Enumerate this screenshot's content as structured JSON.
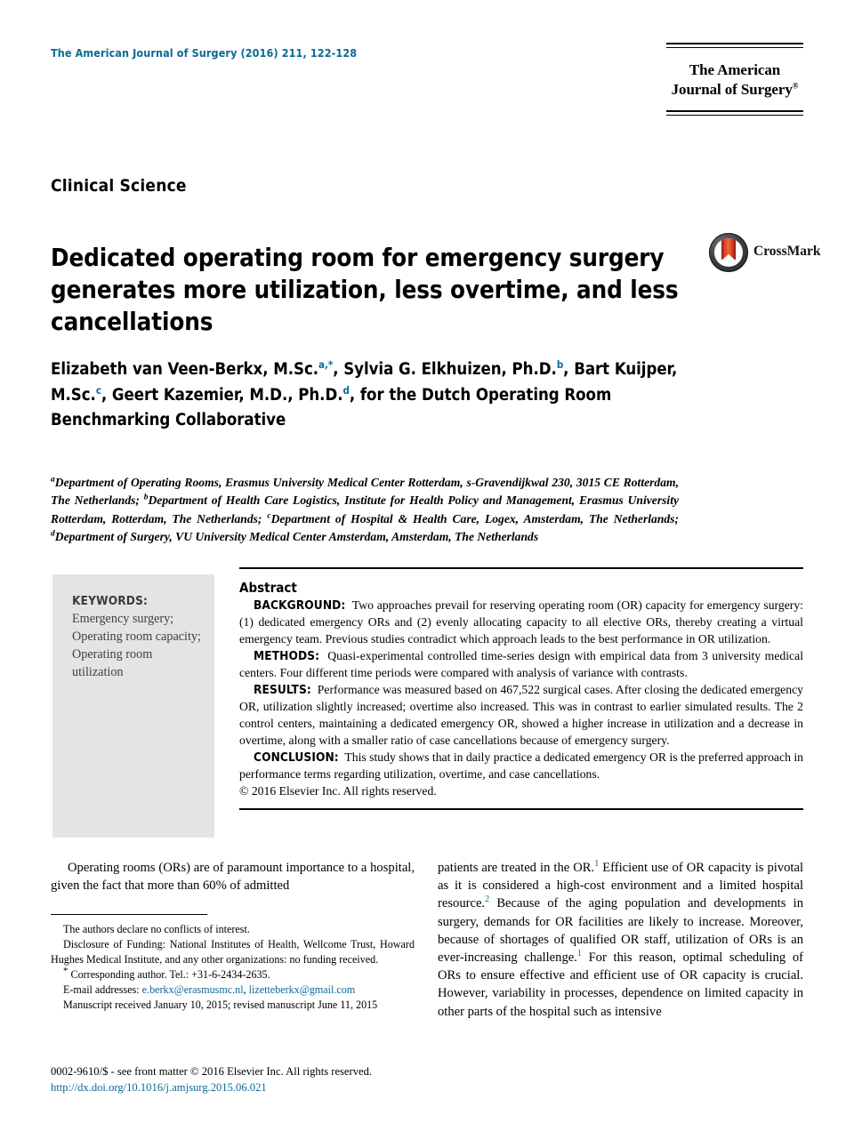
{
  "masthead": {
    "journal_reference": "The American Journal of Surgery (2016) 211, 122-128",
    "logo_line1": "The American",
    "logo_line2": "Journal of Surgery",
    "logo_registered": "®"
  },
  "article": {
    "section_kicker": "Clinical Science",
    "title": "Dedicated operating room for emergency surgery generates more utilization, less overtime, and less cancellations",
    "crossmark_label": "CrossMark"
  },
  "authors": {
    "line1_a": "Elizabeth van Veen-Berkx, M.Sc.",
    "line1_sup1": "a,*",
    "line1_b": ", Sylvia G. Elkhuizen, Ph.D.",
    "line1_sup2": "b",
    "line1_c": ",",
    "line2_a": "Bart Kuijper, M.Sc.",
    "line2_sup1": "c",
    "line2_b": ", Geert Kazemier, M.D., Ph.D.",
    "line2_sup2": "d",
    "line2_c": ", for the Dutch",
    "line3": "Operating Room Benchmarking Collaborative"
  },
  "affiliations": {
    "mark_a": "a",
    "text_a": "Department of Operating Rooms, Erasmus University Medical Center Rotterdam, s-Gravendijkwal 230, 3015 CE Rotterdam, The Netherlands; ",
    "mark_b": "b",
    "text_b": "Department of Health Care Logistics, Institute for Health Policy and Management, Erasmus University Rotterdam, Rotterdam, The Netherlands; ",
    "mark_c": "c",
    "text_c": "Department of Hospital & Health Care, Logex, Amsterdam, The Netherlands; ",
    "mark_d": "d",
    "text_d": "Department of Surgery, VU University Medical Center Amsterdam, Amsterdam, The Netherlands"
  },
  "keywords": {
    "heading": "KEYWORDS:",
    "items": "Emergency surgery; Operating room capacity; Operating room utilization"
  },
  "abstract": {
    "heading": "Abstract",
    "background_label": "BACKGROUND:",
    "background_text": "Two approaches prevail for reserving operating room (OR) capacity for emergency surgery: (1) dedicated emergency ORs and (2) evenly allocating capacity to all elective ORs, thereby creating a virtual emergency team. Previous studies contradict which approach leads to the best performance in OR utilization.",
    "methods_label": "METHODS:",
    "methods_text": "Quasi-experimental controlled time-series design with empirical data from 3 university medical centers. Four different time periods were compared with analysis of variance with contrasts.",
    "results_label": "RESULTS:",
    "results_text": "Performance was measured based on 467,522 surgical cases. After closing the dedicated emergency OR, utilization slightly increased; overtime also increased. This was in contrast to earlier simulated results. The 2 control centers, maintaining a dedicated emergency OR, showed a higher increase in utilization and a decrease in overtime, along with a smaller ratio of case cancellations because of emergency surgery.",
    "conclusion_label": "CONCLUSION:",
    "conclusion_text": "This study shows that in daily practice a dedicated emergency OR is the preferred approach in performance terms regarding utilization, overtime, and case cancellations.",
    "copyright": "© 2016 Elsevier Inc. All rights reserved."
  },
  "body": {
    "left_column": "Operating rooms (ORs) are of paramount importance to a hospital, given the fact that more than 60% of admitted",
    "right_a": "patients are treated in the OR.",
    "right_cite1": "1",
    "right_b": " Efficient use of OR capacity is pivotal as it is considered a high-cost environment and a limited hospital resource.",
    "right_cite2": "2",
    "right_c": " Because of the aging population and developments in surgery, demands for OR facilities are likely to increase. Moreover, because of shortages of qualified OR staff, utilization of ORs is an ever-increasing challenge.",
    "right_cite3": "1",
    "right_d": " For this reason, optimal scheduling of ORs to ensure effective and efficient use of OR capacity is crucial. However, variability in processes, dependence on limited capacity in other parts of the hospital such as intensive"
  },
  "footnotes": {
    "conflicts": "The authors declare no conflicts of interest.",
    "funding": "Disclosure of Funding: National Institutes of Health, Wellcome Trust, Howard Hughes Medical Institute, and any other organizations: no funding received.",
    "corresponding_star": "*",
    "corresponding": " Corresponding author. Tel.: +31-6-2434-2635.",
    "email_label": "E-mail addresses: ",
    "email1": "e.berkx@erasmusmc.nl",
    "email_sep": ", ",
    "email2": "lizetteberkx@gmail.com",
    "manuscript": "Manuscript received January 10, 2015; revised manuscript June 11, 2015"
  },
  "footer": {
    "issn_line": "0002-9610/$ - see front matter © 2016 Elsevier Inc. All rights reserved.",
    "doi": "http://dx.doi.org/10.1016/j.amjsurg.2015.06.021"
  },
  "colors": {
    "accent_teal": "#0b6a95",
    "keywords_bg": "#e4e4e4"
  }
}
